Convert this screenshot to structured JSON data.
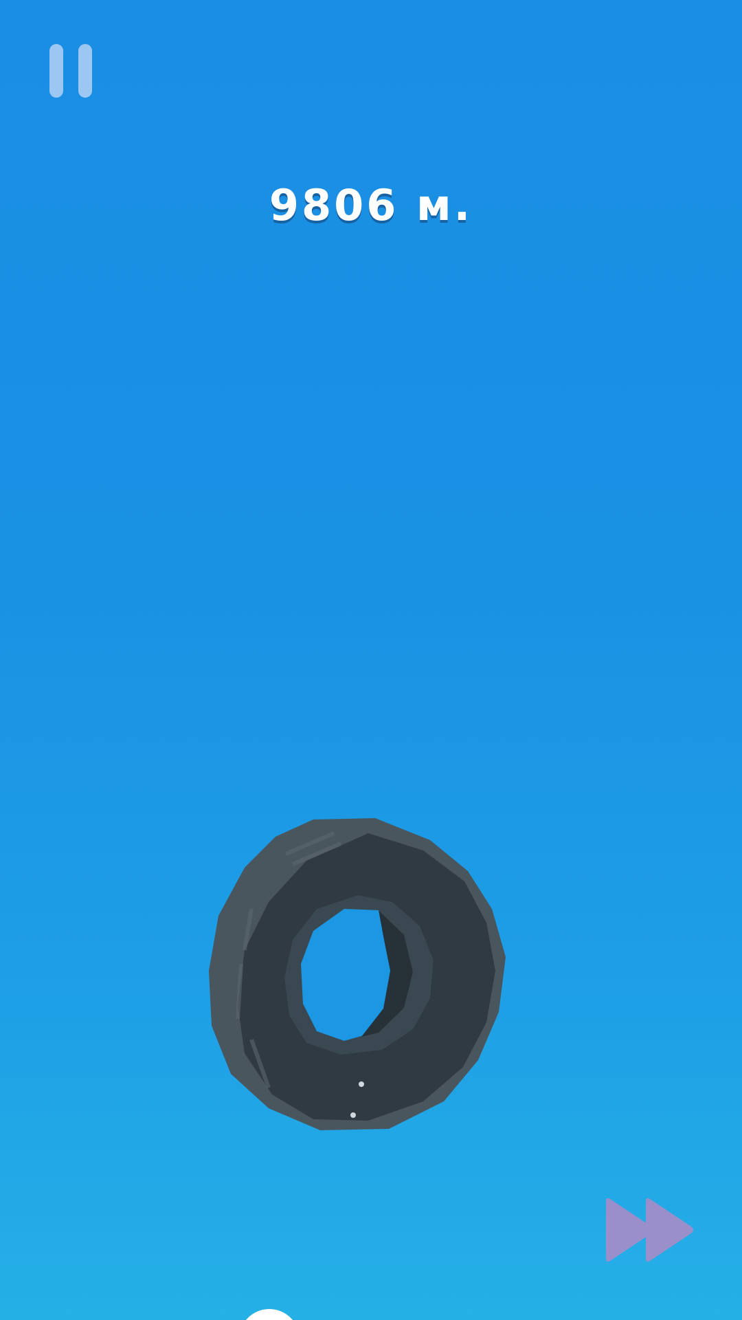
{
  "hud": {
    "distance": "9806 м.",
    "pause_icon": "pause-icon",
    "fast_forward_icon": "fast-forward-icon"
  },
  "colors": {
    "sky_top": "#1a8ee3",
    "sky_bottom": "#25b0e6",
    "pause": "#9cc7f2",
    "fast_forward": "#9a8fcb",
    "tire_dark": "#2f3a42",
    "tire_mid": "#4a565e"
  }
}
